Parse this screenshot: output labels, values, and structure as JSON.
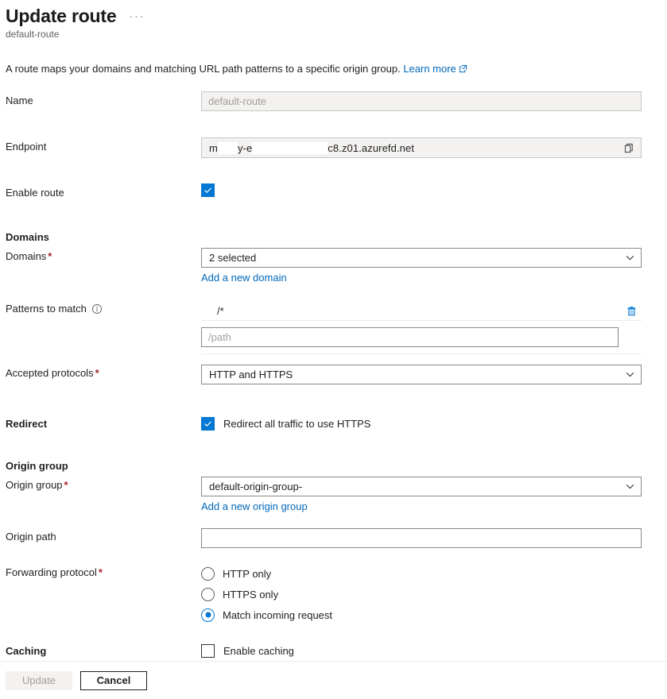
{
  "header": {
    "title": "Update route",
    "subtitle": "default-route",
    "more_menu": "···"
  },
  "description": {
    "text": "A route maps your domains and matching URL path patterns to a specific origin group.",
    "link_label": "Learn more",
    "link_icon": "external-link-icon"
  },
  "fields": {
    "name": {
      "label": "Name",
      "value": "default-route",
      "readonly": true
    },
    "endpoint": {
      "label": "Endpoint",
      "prefix": "m",
      "middle": "y-e",
      "suffix": "c8.z01.azurefd.net",
      "copy_icon": "copy-icon",
      "readonly": true
    },
    "enable_route": {
      "label": "Enable route",
      "checked": true
    }
  },
  "domains_section": {
    "heading": "Domains",
    "label": "Domains",
    "required": "*",
    "selected_value": "2 selected",
    "add_link": "Add a new domain",
    "chevron_icon": "chevron-down-icon"
  },
  "patterns_section": {
    "label": "Patterns to match",
    "info_icon": "info-icon",
    "items": [
      {
        "value": "/*",
        "delete_icon": "trash-icon"
      }
    ],
    "new_placeholder": "/path"
  },
  "accepted_protocols": {
    "label": "Accepted protocols",
    "required": "*",
    "selected_value": "HTTP and HTTPS",
    "chevron_icon": "chevron-down-icon"
  },
  "redirect": {
    "label": "Redirect",
    "checkbox_label": "Redirect all traffic to use HTTPS",
    "checked": true
  },
  "origin_group_section": {
    "heading": "Origin group",
    "label": "Origin group",
    "required": "*",
    "selected_value": "default-origin-group-",
    "add_link": "Add a new origin group",
    "chevron_icon": "chevron-down-icon",
    "origin_path_label": "Origin path",
    "origin_path_value": ""
  },
  "forwarding_protocol": {
    "label": "Forwarding protocol",
    "required": "*",
    "options": [
      {
        "label": "HTTP only",
        "selected": false
      },
      {
        "label": "HTTPS only",
        "selected": false
      },
      {
        "label": "Match incoming request",
        "selected": true
      }
    ]
  },
  "caching": {
    "label": "Caching",
    "checkbox_label": "Enable caching",
    "checked": false
  },
  "footer": {
    "update_label": "Update",
    "update_disabled": true,
    "cancel_label": "Cancel"
  },
  "colors": {
    "accent": "#0078d4",
    "link": "#0067b8",
    "required": "#a4262c",
    "readonly_bg": "#f3f2f1"
  }
}
